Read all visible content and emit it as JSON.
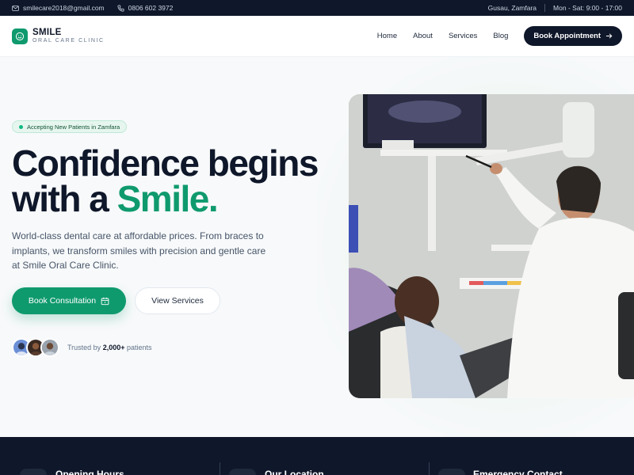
{
  "topbar": {
    "email": "smilecare2018@gmail.com",
    "phone": "0806 602 3972",
    "location": "Gusau, Zamfara",
    "hours": "Mon - Sat: 9:00 - 17:00"
  },
  "header": {
    "logo_name": "SMILE",
    "logo_sub": "ORAL CARE CLINIC",
    "nav": [
      "Home",
      "About",
      "Services",
      "Blog"
    ],
    "book_label": "Book Appointment"
  },
  "hero": {
    "badge": "Accepting New Patients in Zamfara",
    "headline_1": "Confidence begins",
    "headline_2": "with a ",
    "headline_accent": "Smile.",
    "description": "World-class dental care at affordable prices. From braces to implants, we transform smiles with precision and gentle care at Smile Oral Care Clinic.",
    "cta_primary": "Book Consultation",
    "cta_secondary": "View Services",
    "trust_prefix": "Trusted by ",
    "trust_count": "2,000+",
    "trust_suffix": " patients"
  },
  "band": {
    "items": [
      "Opening Hours",
      "Our Location",
      "Emergency Contact"
    ]
  },
  "colors": {
    "accent": "#0f9a6e",
    "dark": "#0f172a"
  },
  "icons": [
    "mail-icon",
    "phone-icon",
    "smile-icon",
    "arrow-right-icon",
    "calendar-icon"
  ]
}
